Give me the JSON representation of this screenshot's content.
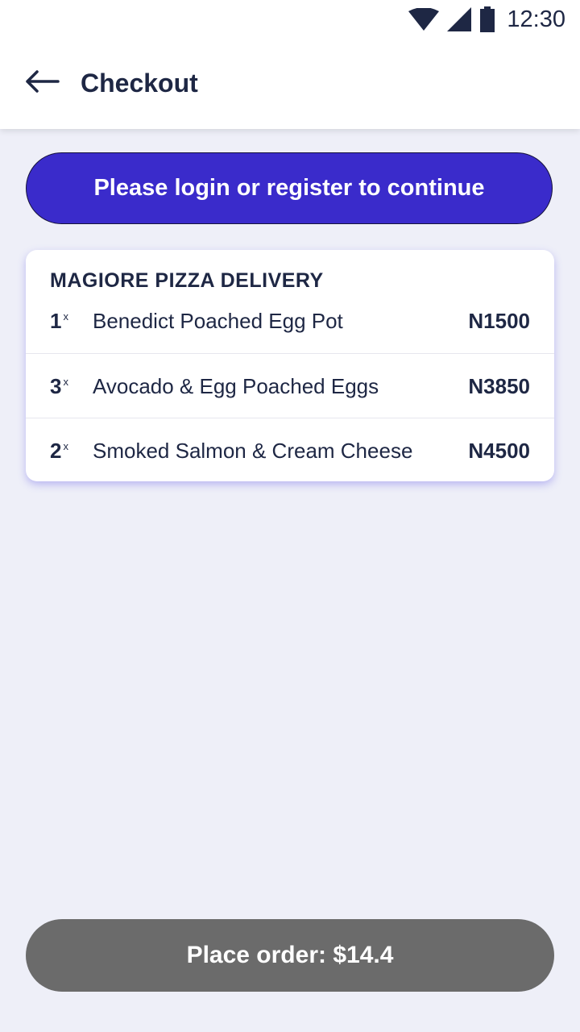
{
  "status_bar": {
    "time": "12:30",
    "icons": [
      "wifi-icon",
      "signal-icon",
      "battery-icon"
    ]
  },
  "header": {
    "title": "Checkout",
    "back_icon": "arrow-left-icon"
  },
  "login_button": {
    "label": "Please login or register to continue"
  },
  "order": {
    "restaurant": "MAGIORE PIZZA DELIVERY",
    "qty_suffix": "x",
    "items": [
      {
        "qty": "1",
        "name": "Benedict Poached Egg Pot",
        "price": "N1500"
      },
      {
        "qty": "3",
        "name": "Avocado & Egg Poached Eggs",
        "price": "N3850"
      },
      {
        "qty": "2",
        "name": "Smoked Salmon & Cream Cheese",
        "price": "N4500"
      }
    ]
  },
  "place_order": {
    "label": "Place order: $14.4"
  },
  "colors": {
    "primary": "#3A2BCB",
    "text": "#1E2744",
    "background": "#EEEFF8",
    "disabled_button": "#6B6B6B"
  }
}
